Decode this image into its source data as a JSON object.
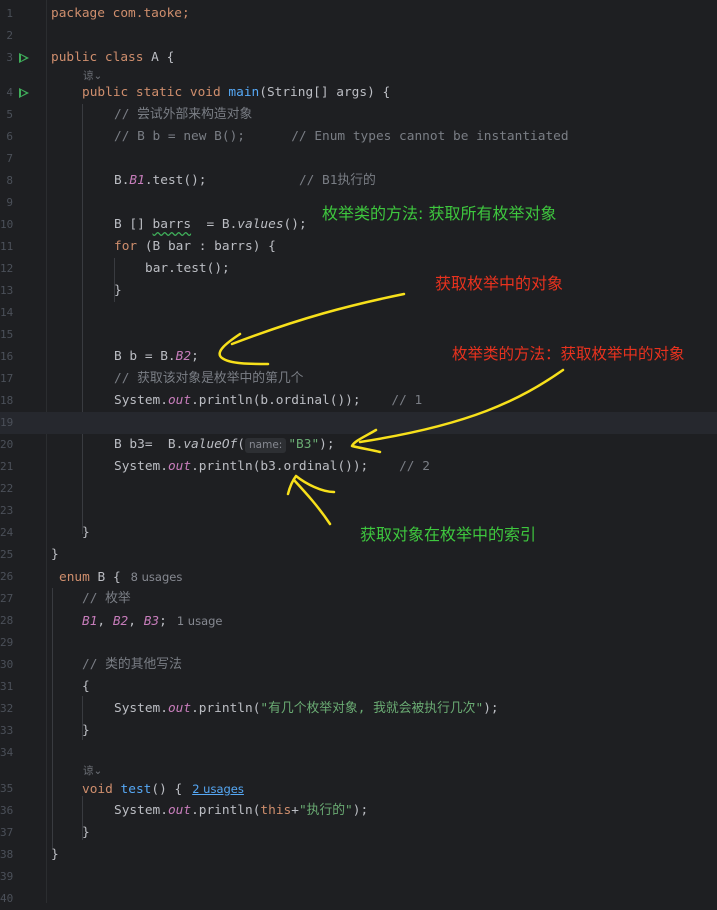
{
  "code": {
    "l1": "package com.taoke;",
    "l3_kw": "public class",
    "l3_rest": " A {",
    "l3a_author": "谅⌄",
    "l4_kw": "public static void",
    "l4_fn": "main",
    "l4_rest": "(String[] args) {",
    "l5": "// 尝试外部来构造对象",
    "l6": "// B b = new B();      // Enum types cannot be instantiated",
    "l8_a": "B.",
    "l8_b": "B1",
    "l8_c": ".test();            ",
    "l8_cm": "// B1执行的",
    "l10_a": "B [] ",
    "l10_b": "barrs",
    "l10_c": "  = B.",
    "l10_d": "values",
    "l10_e": "();",
    "l11_kw": "for",
    "l11_rest": " (B bar : barrs) {",
    "l12": "bar.test();",
    "l13": "}",
    "l16_a": "B b = B.",
    "l16_b": "B2",
    "l16_c": ";",
    "l17": "// 获取该对象是枚举中的第几个",
    "l18_a": "System.",
    "l18_b": "out",
    "l18_c": ".println(b.ordinal());    ",
    "l18_cm": "// 1",
    "l20_a": "B b3=  B.",
    "l20_b": "valueOf",
    "l20_c": "(",
    "l20_hint": "name:",
    "l20_str": "\"B3\"",
    "l20_d": ");",
    "l21_a": "System.",
    "l21_b": "out",
    "l21_c": ".println(b3.ordinal());    ",
    "l21_cm": "// 2",
    "l24": "}",
    "l25": "}",
    "l26_kw": "enum",
    "l26_rest": " B {",
    "l26_usage": "8 usages",
    "l27": "// 枚举",
    "l28_b1": "B1",
    "l28_sep1": ", ",
    "l28_b2": "B2",
    "l28_sep2": ", ",
    "l28_b3": "B3",
    "l28_semi": ";",
    "l28_usage": "1 usage",
    "l30": "// 类的其他写法",
    "l31": "{",
    "l32_a": "System.",
    "l32_b": "out",
    "l32_c": ".println(",
    "l32_str": "\"有几个枚举对象, 我就会被执行几次\"",
    "l32_d": ");",
    "l33": "}",
    "l34a_author": "谅⌄",
    "l35_kw": "void",
    "l35_fn": "test",
    "l35_rest": "() {",
    "l35_usage": "2 usages",
    "l36_a": "System.",
    "l36_b": "out",
    "l36_c": ".println(",
    "l36_kw": "this",
    "l36_plus": "+",
    "l36_str": "\"执行的\"",
    "l36_d": ");",
    "l37": "}",
    "l38": "}"
  },
  "annotations": {
    "a1": "枚举类的方法:  获取所有枚举对象",
    "a2": "获取枚举中的对象",
    "a3": "枚举类的方法：获取枚举中的对象",
    "a4": "获取对象在枚举中的索引"
  },
  "colors": {
    "background": "#1e1f22",
    "keyword": "#cf8e6d",
    "function": "#56a8f5",
    "static_field": "#c77dbb",
    "comment": "#7a7e85",
    "string": "#6aab73",
    "annotation_green": "#3ec73e",
    "annotation_red": "#e8321e",
    "annotation_arrow": "#f7e01b"
  }
}
